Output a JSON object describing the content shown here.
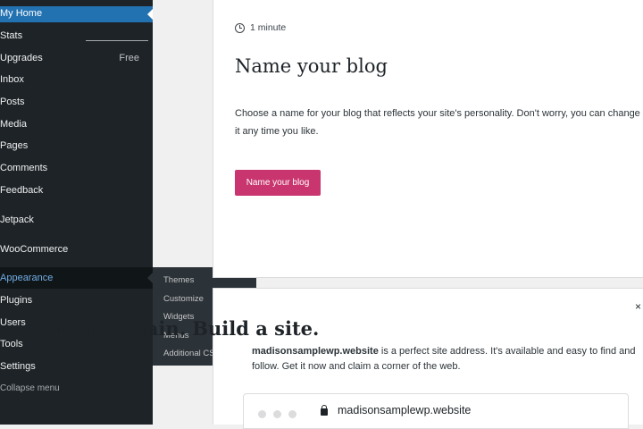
{
  "sidebar": {
    "items": [
      {
        "label": "My Home"
      },
      {
        "label": "Stats"
      },
      {
        "label": "Upgrades",
        "badge": "Free"
      },
      {
        "label": "Inbox"
      },
      {
        "label": "Posts"
      },
      {
        "label": "Media"
      },
      {
        "label": "Pages"
      },
      {
        "label": "Comments"
      },
      {
        "label": "Feedback"
      },
      {
        "label": "Jetpack"
      },
      {
        "label": "WooCommerce"
      },
      {
        "label": "Appearance"
      },
      {
        "label": "Plugins"
      },
      {
        "label": "Users"
      },
      {
        "label": "Tools"
      },
      {
        "label": "Settings"
      }
    ],
    "collapse_label": "Collapse menu"
  },
  "appearance_submenu": [
    "Themes",
    "Customize",
    "Widgets",
    "Menus",
    "Additional CSS"
  ],
  "task_card": {
    "time_estimate": "1 minute",
    "title": "Name your blog",
    "description": "Choose a name for your blog that reflects your site's personality. Don't worry, you can change it any time you like.",
    "button_label": "Name your blog"
  },
  "domain_card": {
    "title": "Own a domain. Build a site.",
    "domain_bold": "madisonsamplewp.website",
    "description_rest": " is a perfect site address. It's available and easy to find and follow. Get it now and claim a corner of the web.",
    "close_symbol": "×",
    "url": "madisonsamplewp.website"
  },
  "colors": {
    "sidebar_bg": "#1d2327",
    "active_bg": "#2271b1",
    "accent_link": "#72aee6",
    "primary_button": "#c9356e"
  }
}
